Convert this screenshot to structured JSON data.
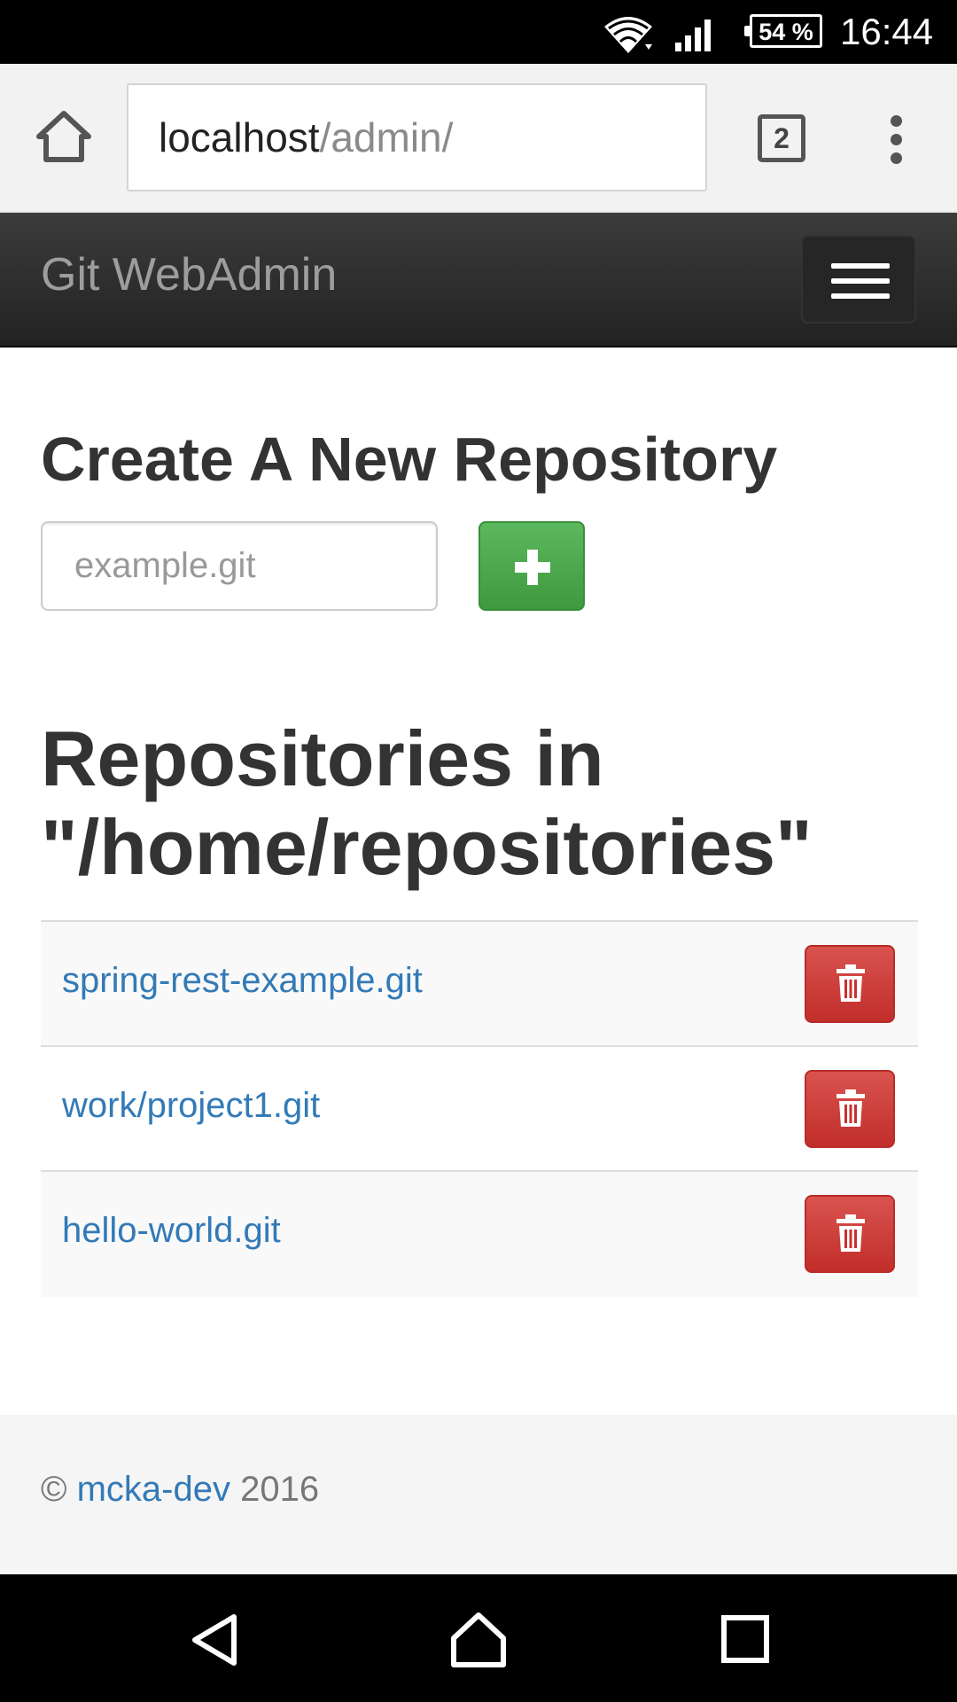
{
  "status_bar": {
    "battery": "54 %",
    "time": "16:44",
    "icons": [
      "wifi-icon",
      "signal-icon",
      "battery-icon"
    ]
  },
  "browser": {
    "url_host": "localhost",
    "url_path": "/admin/",
    "tab_count": "2",
    "icons": [
      "home-icon",
      "more-vert-icon"
    ]
  },
  "navbar": {
    "brand": "Git WebAdmin",
    "toggle_icon": "hamburger-menu-icon"
  },
  "create": {
    "title": "Create A New Repository",
    "input_placeholder": "example.git",
    "input_value": "",
    "add_icon": "plus-icon"
  },
  "repositories": {
    "title_line1": "Repositories in",
    "title_line2": "\"/home/repositories\"",
    "items": [
      {
        "name": "spring-rest-example.git"
      },
      {
        "name": "work/project1.git"
      },
      {
        "name": "hello-world.git"
      }
    ],
    "delete_icon": "trash-icon"
  },
  "footer": {
    "copyright_symbol": "©",
    "author": "mcka-dev",
    "year": "2016"
  },
  "system_nav": {
    "icons": [
      "back-icon",
      "home-icon",
      "recents-icon"
    ]
  },
  "colors": {
    "navbar": "#222222",
    "success": "#5cb85c",
    "danger": "#d9534f",
    "link": "#337ab7"
  }
}
